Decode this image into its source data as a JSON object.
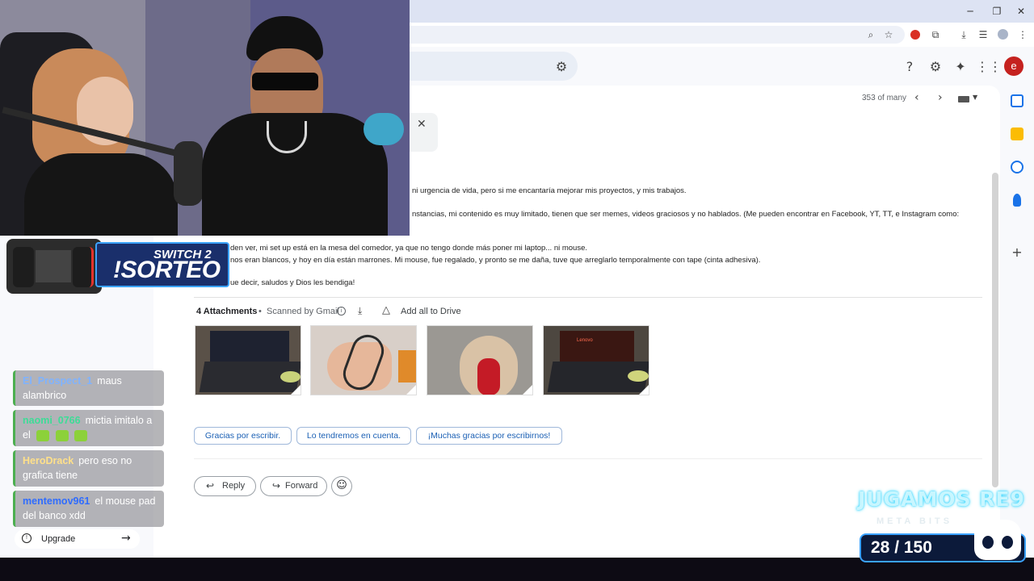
{
  "browser": {
    "window_controls": {
      "minimize": "─",
      "restore": "❐",
      "close": "✕"
    }
  },
  "gmail": {
    "pager": "353 of many",
    "avatar_letter": "e",
    "body_lines": [
      "ni urgencia de vida, pero si me encantaría mejorar mis proyectos, y mis trabajos.",
      "nstancias, mi contenido es muy limitado, tienen que ser memes, videos graciosos y no hablados. (Me pueden encontrar en Facebook, YT, TT, e Instagram como:",
      "den ver, mi set up está en la mesa del comedor, ya que no tengo donde más poner mi laptop... ni mouse.",
      "nos eran blancos, y hoy en día están marrones. Mi mouse, fue regalado, y pronto se me daña, tuve que arreglarlo temporalmente con tape (cinta adhesiva).",
      "ue decir, saludos y Dios les bendiga!"
    ],
    "attachments": {
      "count_label": "4 Attachments",
      "separator": "•",
      "scanned_label": "Scanned by Gmail",
      "info_glyph": "i",
      "add_drive_label": "Add all to Drive"
    },
    "thumb_text": "Lenovo",
    "smart_replies": [
      "Gracias por escribir.",
      "Lo tendremos en cuenta.",
      "¡Muchas gracias por escribirnos!"
    ],
    "actions": {
      "reply": "Reply",
      "forward": "Forward"
    },
    "upgrade_label": "Upgrade",
    "upgrade_glyph": "!"
  },
  "stream": {
    "giveaway": {
      "top": "SWITCH 2",
      "main": "!SORTEO"
    },
    "chat": [
      {
        "user": "El_Prospect_1",
        "message": "maus alambrico",
        "color": "#7fb3ff"
      },
      {
        "user": "naomi_0766",
        "message": "mictia imitalo a el",
        "color": "#3ddc97"
      },
      {
        "user": "HeroDrack",
        "message": "pero eso no grafica tiene",
        "color": "#ffe08a"
      },
      {
        "user": "mentemov961",
        "message": "el mouse pad del banco xdd",
        "color": "#2f6cff"
      }
    ],
    "goal": {
      "title": "JUGAMOS RE9",
      "subtitle": "META BITS",
      "count": "28 / 150"
    }
  },
  "colors": {
    "accent": "#1a73e8",
    "chip_border": "#9fb8da",
    "overlay_blue": "#3ba3ff"
  }
}
